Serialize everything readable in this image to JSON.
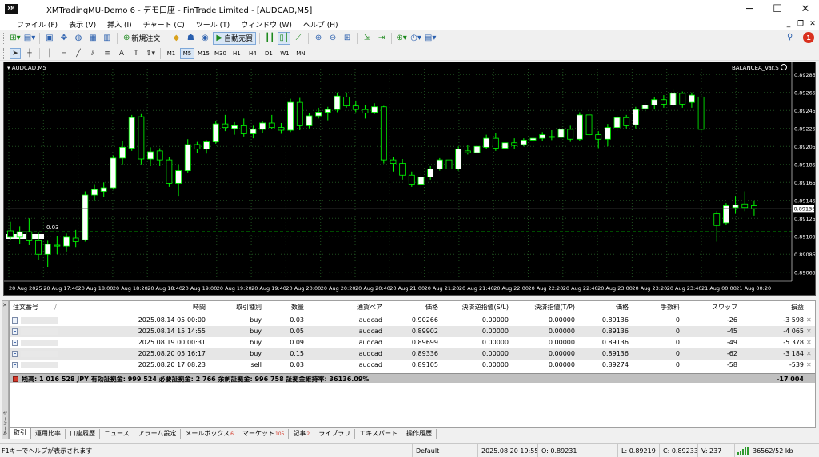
{
  "window": {
    "app_icon_text": "XM",
    "title": "XMTradingMU-Demo 6 - デモ口座 - FinTrade Limited - [AUDCAD,M5]",
    "controls": {
      "minimize": "─",
      "maximize": "☐",
      "close": "✕"
    },
    "mdi": {
      "minimize": "_",
      "restore": "❐",
      "close": "✕"
    }
  },
  "menu": [
    "ファイル (F)",
    "表示 (V)",
    "挿入 (I)",
    "チャート (C)",
    "ツール (T)",
    "ウィンドウ (W)",
    "ヘルプ (H)"
  ],
  "toolbar1": {
    "new_order_label": "新規注文",
    "autotrade_label": "自動売買",
    "notification_count": "1"
  },
  "timeframes": [
    "M1",
    "M5",
    "M15",
    "M30",
    "H1",
    "H4",
    "D1",
    "W1",
    "MN"
  ],
  "active_timeframe": "M5",
  "chart": {
    "symbol_label": "▾ AUDCAD,M5",
    "ea_label": "BALANCEA_Var.S",
    "price_labels": [
      "0.89285",
      "0.89265",
      "0.89245",
      "0.89225",
      "0.89205",
      "0.89185",
      "0.89165",
      "0.89145",
      "0.89125",
      "0.89105",
      "0.89085",
      "0.89065"
    ],
    "current_price": "0.89136",
    "position_line_label": "0.03",
    "time_labels": [
      "20 Aug 2025",
      "20 Aug 17:40",
      "20 Aug 18:00",
      "20 Aug 18:20",
      "20 Aug 18:40",
      "20 Aug 19:00",
      "20 Aug 19:20",
      "20 Aug 19:40",
      "20 Aug 20:00",
      "20 Aug 20:20",
      "20 Aug 20:40",
      "20 Aug 21:00",
      "20 Aug 21:20",
      "20 Aug 21:40",
      "20 Aug 22:00",
      "20 Aug 22:20",
      "20 Aug 22:40",
      "20 Aug 23:00",
      "20 Aug 23:20",
      "20 Aug 23:40",
      "21 Aug 00:00",
      "21 Aug 00:20"
    ],
    "colors": {
      "background": "#000000",
      "bull": "#ffffff",
      "bear": "#000000",
      "wick": "#00ff00",
      "grid": "#1f4f1f",
      "text": "#ffffff"
    }
  },
  "chart_data": {
    "type": "candlestick",
    "symbol": "AUDCAD",
    "timeframe": "M5",
    "ylim": [
      0.89055,
      0.89295
    ],
    "current_price": 0.89136,
    "position_line": 0.8911,
    "candles": [
      [
        0.89111,
        0.89121,
        0.89101,
        0.89104
      ],
      [
        0.89104,
        0.89116,
        0.89096,
        0.8911
      ],
      [
        0.8911,
        0.89125,
        0.89095,
        0.891
      ],
      [
        0.891,
        0.89109,
        0.89079,
        0.89085
      ],
      [
        0.89085,
        0.891,
        0.89071,
        0.89096
      ],
      [
        0.89095,
        0.89105,
        0.89085,
        0.89094
      ],
      [
        0.89094,
        0.89108,
        0.89088,
        0.89104
      ],
      [
        0.89103,
        0.89112,
        0.89093,
        0.89099
      ],
      [
        0.89101,
        0.89155,
        0.89099,
        0.89151
      ],
      [
        0.89151,
        0.89163,
        0.89145,
        0.89157
      ],
      [
        0.89155,
        0.89165,
        0.89149,
        0.89159
      ],
      [
        0.89159,
        0.89195,
        0.89157,
        0.89192
      ],
      [
        0.89192,
        0.89211,
        0.89185,
        0.89204
      ],
      [
        0.89203,
        0.8924,
        0.892,
        0.89237
      ],
      [
        0.89238,
        0.89241,
        0.89185,
        0.89191
      ],
      [
        0.89191,
        0.89204,
        0.89183,
        0.89199
      ],
      [
        0.892,
        0.89203,
        0.89183,
        0.8919
      ],
      [
        0.8919,
        0.89193,
        0.8916,
        0.89164
      ],
      [
        0.89164,
        0.89185,
        0.8915,
        0.89178
      ],
      [
        0.89178,
        0.89213,
        0.89176,
        0.89207
      ],
      [
        0.89207,
        0.8921,
        0.89198,
        0.89202
      ],
      [
        0.89202,
        0.89212,
        0.89197,
        0.8921
      ],
      [
        0.8921,
        0.89233,
        0.89208,
        0.8923
      ],
      [
        0.8923,
        0.8924,
        0.89222,
        0.89226
      ],
      [
        0.89225,
        0.89232,
        0.89218,
        0.89228
      ],
      [
        0.89228,
        0.89236,
        0.89216,
        0.89219
      ],
      [
        0.89219,
        0.89228,
        0.89214,
        0.89224
      ],
      [
        0.89224,
        0.89233,
        0.8922,
        0.89231
      ],
      [
        0.89231,
        0.8924,
        0.89224,
        0.89226
      ],
      [
        0.89226,
        0.89231,
        0.89219,
        0.89223
      ],
      [
        0.89223,
        0.89258,
        0.89221,
        0.89254
      ],
      [
        0.89254,
        0.89259,
        0.89223,
        0.89228
      ],
      [
        0.89228,
        0.89242,
        0.89225,
        0.89239
      ],
      [
        0.89239,
        0.89248,
        0.89236,
        0.89243
      ],
      [
        0.89243,
        0.89249,
        0.89234,
        0.89246
      ],
      [
        0.89246,
        0.89265,
        0.89243,
        0.89261
      ],
      [
        0.8926,
        0.89265,
        0.89248,
        0.8925
      ],
      [
        0.8925,
        0.89256,
        0.89243,
        0.89246
      ],
      [
        0.89246,
        0.89251,
        0.89236,
        0.89242
      ],
      [
        0.89243,
        0.89253,
        0.89241,
        0.89249
      ],
      [
        0.89249,
        0.8925,
        0.89186,
        0.8919
      ],
      [
        0.8919,
        0.89193,
        0.89177,
        0.89186
      ],
      [
        0.89186,
        0.89191,
        0.89168,
        0.89173
      ],
      [
        0.89173,
        0.89177,
        0.8916,
        0.89163
      ],
      [
        0.89163,
        0.89175,
        0.89157,
        0.89171
      ],
      [
        0.89171,
        0.89183,
        0.89168,
        0.8918
      ],
      [
        0.8918,
        0.89192,
        0.89178,
        0.8919
      ],
      [
        0.8919,
        0.89193,
        0.89177,
        0.8918
      ],
      [
        0.8918,
        0.89205,
        0.89178,
        0.89202
      ],
      [
        0.892,
        0.89207,
        0.89196,
        0.89198
      ],
      [
        0.89198,
        0.89207,
        0.89194,
        0.89205
      ],
      [
        0.89204,
        0.89218,
        0.89202,
        0.89214
      ],
      [
        0.89214,
        0.8922,
        0.892,
        0.89203
      ],
      [
        0.89203,
        0.89211,
        0.89196,
        0.89209
      ],
      [
        0.89209,
        0.89214,
        0.89202,
        0.89206
      ],
      [
        0.89207,
        0.89214,
        0.89205,
        0.89212
      ],
      [
        0.89212,
        0.89218,
        0.89208,
        0.89214
      ],
      [
        0.89214,
        0.89221,
        0.89211,
        0.89218
      ],
      [
        0.89216,
        0.89223,
        0.89212,
        0.89215
      ],
      [
        0.89215,
        0.89228,
        0.8921,
        0.89224
      ],
      [
        0.89224,
        0.89228,
        0.8921,
        0.89213
      ],
      [
        0.89213,
        0.89243,
        0.89211,
        0.8924
      ],
      [
        0.8924,
        0.89243,
        0.89215,
        0.89218
      ],
      [
        0.89218,
        0.89222,
        0.89203,
        0.89213
      ],
      [
        0.89213,
        0.8923,
        0.89205,
        0.89226
      ],
      [
        0.89226,
        0.8924,
        0.89222,
        0.89237
      ],
      [
        0.89237,
        0.8924,
        0.89225,
        0.89228
      ],
      [
        0.89229,
        0.89249,
        0.89225,
        0.89246
      ],
      [
        0.89247,
        0.89254,
        0.89243,
        0.89251
      ],
      [
        0.89251,
        0.8926,
        0.89246,
        0.89257
      ],
      [
        0.89257,
        0.89262,
        0.89248,
        0.89252
      ],
      [
        0.89251,
        0.89268,
        0.89249,
        0.89264
      ],
      [
        0.89264,
        0.89266,
        0.89248,
        0.89252
      ],
      [
        0.89254,
        0.89265,
        0.89248,
        0.89262
      ],
      [
        0.8926,
        0.89262,
        0.8922,
        0.89224
      ],
      [
        0.8913,
        0.89133,
        0.89099,
        0.89117
      ],
      [
        0.8912,
        0.89142,
        0.89118,
        0.89139
      ],
      [
        0.89137,
        0.8915,
        0.8913,
        0.8914
      ],
      [
        0.89141,
        0.89155,
        0.89133,
        0.89137
      ],
      [
        0.89139,
        0.89145,
        0.89128,
        0.89136
      ]
    ]
  },
  "terminal": {
    "side_label": "ターミナル",
    "columns": [
      "注文番号",
      "時間",
      "取引種別",
      "数量",
      "通貨ペア",
      "価格",
      "決済逆指値(S/L)",
      "決済指値(T/P)",
      "価格",
      "手数料",
      "スワップ",
      "損益"
    ],
    "sort_indicator": "/",
    "orders": [
      {
        "time": "2025.08.14 05:00:00",
        "type": "buy",
        "volume": "0.03",
        "symbol": "audcad",
        "price": "0.90266",
        "sl": "0.00000",
        "tp": "0.00000",
        "current": "0.89136",
        "commission": "0",
        "swap": "-26",
        "profit": "-3 598"
      },
      {
        "time": "2025.08.14 15:14:55",
        "type": "buy",
        "volume": "0.05",
        "symbol": "audcad",
        "price": "0.89902",
        "sl": "0.00000",
        "tp": "0.00000",
        "current": "0.89136",
        "commission": "0",
        "swap": "-45",
        "profit": "-4 065"
      },
      {
        "time": "2025.08.19 00:00:31",
        "type": "buy",
        "volume": "0.09",
        "symbol": "audcad",
        "price": "0.89699",
        "sl": "0.00000",
        "tp": "0.00000",
        "current": "0.89136",
        "commission": "0",
        "swap": "-49",
        "profit": "-5 378"
      },
      {
        "time": "2025.08.20 05:16:17",
        "type": "buy",
        "volume": "0.15",
        "symbol": "audcad",
        "price": "0.89336",
        "sl": "0.00000",
        "tp": "0.00000",
        "current": "0.89136",
        "commission": "0",
        "swap": "-62",
        "profit": "-3 184"
      },
      {
        "time": "2025.08.20 17:08:23",
        "type": "sell",
        "volume": "0.03",
        "symbol": "audcad",
        "price": "0.89105",
        "sl": "0.00000",
        "tp": "0.00000",
        "current": "0.89274",
        "commission": "0",
        "swap": "-58",
        "profit": "-539"
      }
    ],
    "close_glyph": "✕",
    "balance_line": "残高: 1 016 528 JPY  有効証拠金: 999 524  必要証拠金: 2 766  余剰証拠金: 996 758  証拠金維持率: 36136.09%",
    "balance_total": "-17 004"
  },
  "tabs": [
    {
      "label": "取引",
      "sup": ""
    },
    {
      "label": "運用比率",
      "sup": ""
    },
    {
      "label": "口座履歴",
      "sup": ""
    },
    {
      "label": "ニュース",
      "sup": ""
    },
    {
      "label": "アラーム設定",
      "sup": ""
    },
    {
      "label": "メールボックス",
      "sup": "6"
    },
    {
      "label": "マーケット",
      "sup": "105"
    },
    {
      "label": "記事",
      "sup": "2"
    },
    {
      "label": "ライブラリ",
      "sup": ""
    },
    {
      "label": "エキスパート",
      "sup": ""
    },
    {
      "label": "操作履歴",
      "sup": ""
    }
  ],
  "statusbar": {
    "help": "F1キーでヘルプが表示されます",
    "profile": "Default",
    "datetime": "2025.08.20 19:55",
    "open": "O: 0.89231",
    "high": "H: 0.89231",
    "low": "L: 0.89219",
    "close": "C: 0.89233",
    "volume": "V: 237",
    "traffic": "36562/52 kb"
  }
}
